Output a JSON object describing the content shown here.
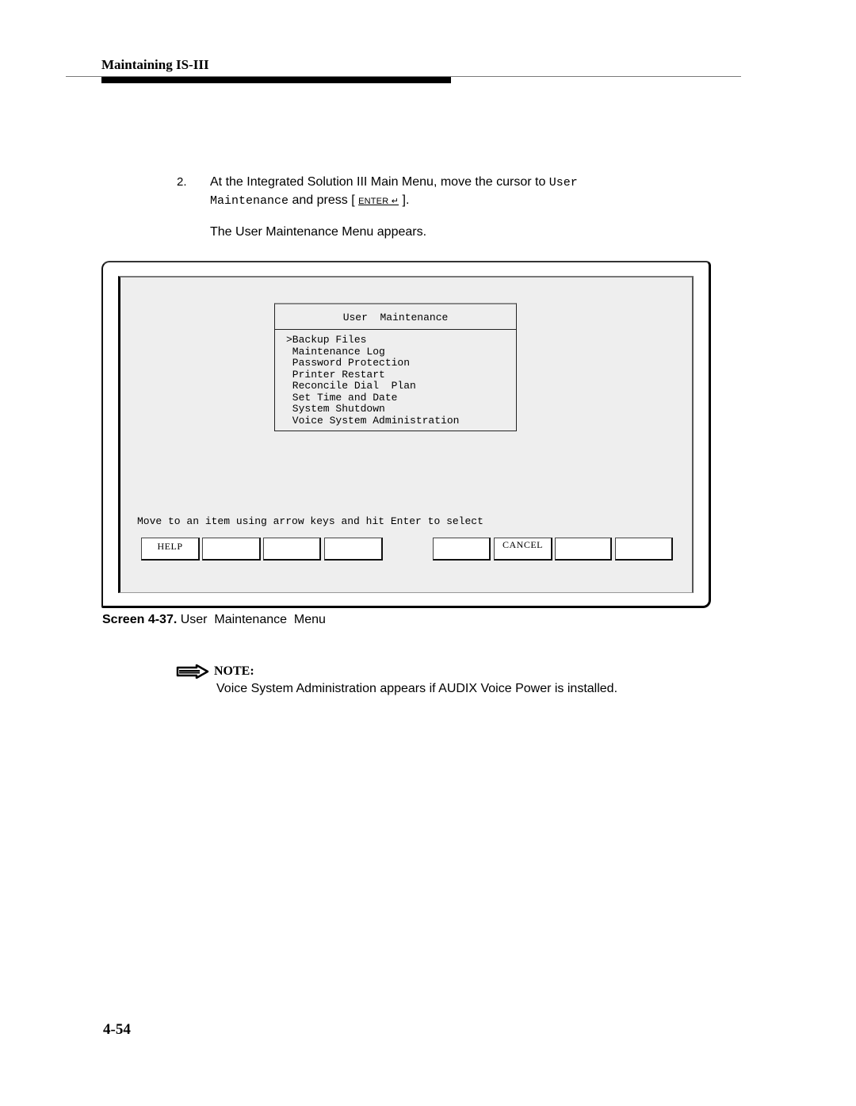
{
  "header": {
    "running_head": "Maintaining IS-III"
  },
  "step": {
    "number": "2.",
    "text_before": "At the Integrated Solution III Main Menu, move the cursor to ",
    "mono_line1": "User",
    "mono_line2": "Maintenance",
    "text_press": " and press [ ",
    "key_label": "ENTER ↵",
    "text_after": " ].",
    "result": "The User Maintenance Menu appears."
  },
  "screen": {
    "menu_title": "User  Maintenance",
    "menu_items": [
      ">Backup Files",
      " Maintenance Log",
      " Password Protection",
      " Printer Restart",
      " Reconcile Dial  Plan",
      " Set Time and Date",
      " System Shutdown",
      " Voice System Administration"
    ],
    "selected_index": 0,
    "status_line": "Move to an item using arrow keys and hit Enter to select",
    "function_keys": [
      "HELP",
      "",
      "",
      "",
      "",
      "CANCEL",
      "",
      ""
    ]
  },
  "caption": {
    "label": "Screen 4-37.",
    "title": " User  Maintenance  Menu"
  },
  "note": {
    "icon": "note-arrow-icon",
    "label": "NOTE:",
    "text": "Voice System Administration appears if AUDIX Voice Power is installed."
  },
  "footer": {
    "page_number": "4-54"
  }
}
